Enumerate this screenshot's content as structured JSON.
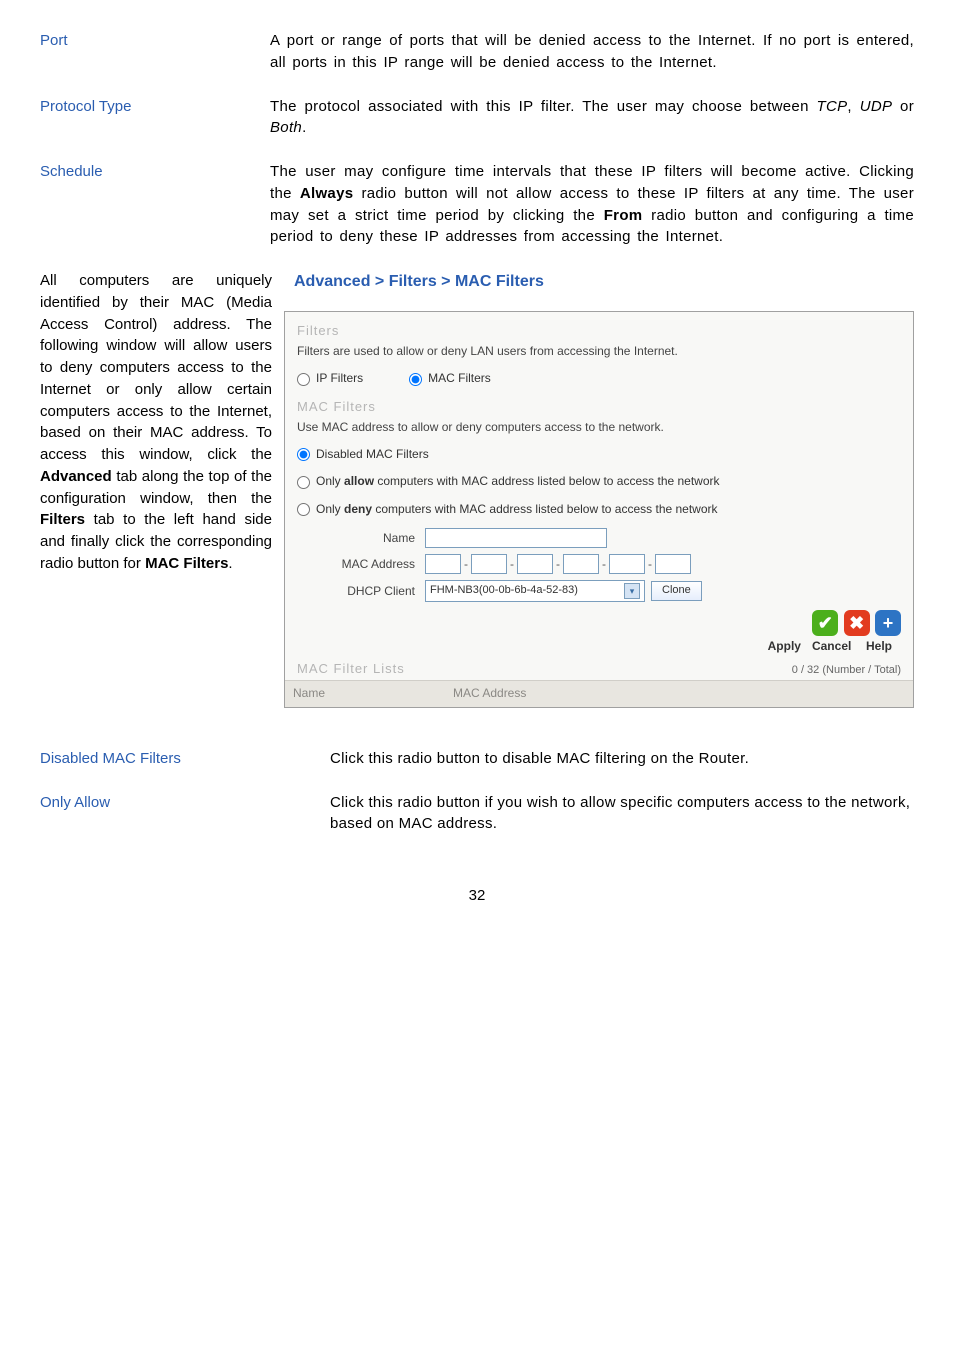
{
  "terms": {
    "port": {
      "label": "Port",
      "body": "A port or range of ports that will be denied access to the Internet. If no port is entered, all ports in this IP range will be denied access to the Internet."
    },
    "protocol": {
      "label": "Protocol Type",
      "body_prefix": "The protocol associated with this IP filter. The user may choose between ",
      "italic1": "TCP",
      "sep1": ", ",
      "italic2": "UDP",
      "sep2": " or ",
      "italic3": "Both",
      "suffix": "."
    },
    "schedule": {
      "label": "Schedule",
      "body_a": "The user may configure time intervals that these IP filters will become active. Clicking the ",
      "bold_a": "Always",
      "body_b": " radio button will not allow access to these IP filters at any time. The user may set a strict time period by clicking the ",
      "bold_b": "From",
      "body_c": " radio button and configuring a time period to deny these IP addresses from accessing the Internet."
    }
  },
  "left_paragraph": {
    "a": "All computers are uniquely identified by their MAC (Media Access Control) address. The following window will allow users to deny computers access to the Internet or only allow certain computers access to the Internet, based on their MAC address. To access this window, click the ",
    "bold1": "Advanced",
    "b": " tab along the top of the configuration window, then the ",
    "bold2": "Filters",
    "c": " tab to the left hand side and finally click the corresponding radio button for ",
    "bold3": "MAC Filters",
    "d": "."
  },
  "section_heading": "Advanced > Filters > MAC Filters",
  "screenshot": {
    "filters_title": "Filters",
    "filters_desc": "Filters are used to allow or deny LAN users from accessing the Internet.",
    "radio_ip": "IP Filters",
    "radio_mac": "MAC Filters",
    "mac_section_title": "MAC Filters",
    "mac_section_desc": "Use MAC address to allow or deny computers access to the network.",
    "opt_disabled": "Disabled MAC Filters",
    "opt_allow_pre": "Only ",
    "opt_allow_bold": "allow",
    "opt_allow_post": " computers with MAC address listed below to access the network",
    "opt_deny_pre": "Only ",
    "opt_deny_bold": "deny",
    "opt_deny_post": " computers with MAC address listed below to access the network",
    "lbl_name": "Name",
    "lbl_mac": "MAC Address",
    "lbl_dhcp": "DHCP Client",
    "sep": "-",
    "dhcp_value": "FHM-NB3(00-0b-6b-4a-52-83)",
    "btn_clone": "Clone",
    "apply": "Apply",
    "cancel": "Cancel",
    "help": "Help",
    "list_title": "MAC Filter Lists",
    "count": "0 / 32 (Number / Total)",
    "col_name": "Name",
    "col_mac": "MAC Address"
  },
  "below": {
    "disabled": {
      "label": "Disabled MAC Filters",
      "body": "Click this radio button to disable MAC filtering on the Router."
    },
    "allow": {
      "label": "Only Allow",
      "body": "Click this radio button if you wish to allow specific computers access to the network, based on MAC address."
    }
  },
  "pagenum": "32"
}
